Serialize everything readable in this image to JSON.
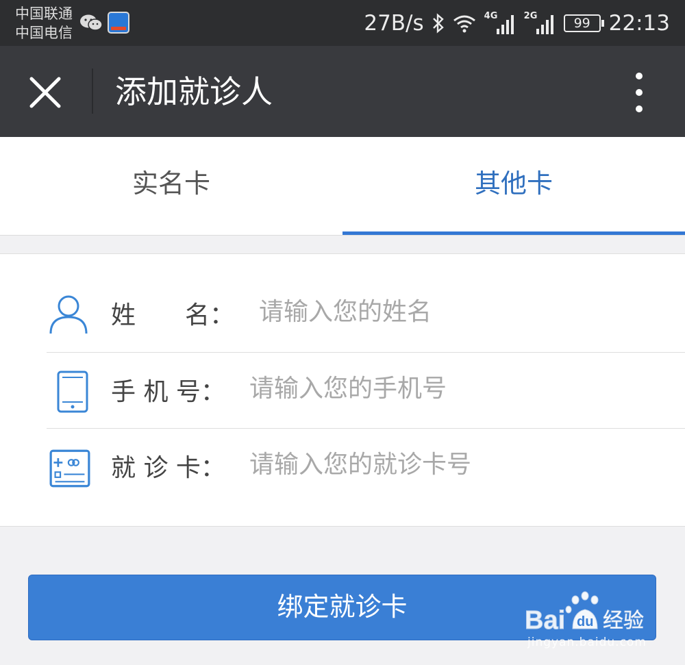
{
  "status_bar": {
    "carrier_1": "中国联通",
    "carrier_2": "中国电信",
    "net_speed": "27B/s",
    "sig_tag_1": "4G",
    "sig_tag_2": "2G",
    "battery": "99",
    "time": "22:13"
  },
  "title_bar": {
    "title": "添加就诊人"
  },
  "tabs": [
    {
      "label": "实名卡",
      "active": false
    },
    {
      "label": "其他卡",
      "active": true
    }
  ],
  "form": {
    "name_label": "姓　　名：",
    "name_placeholder": "请输入您的姓名",
    "phone_label": "手 机 号：",
    "phone_placeholder": "请输入您的手机号",
    "card_label": "就 诊 卡：",
    "card_placeholder": "请输入您的就诊卡号"
  },
  "submit_label": "绑定就诊卡",
  "watermark": {
    "site": "jingyan.baidu.com"
  },
  "colors": {
    "accent": "#3a7fd5",
    "active_tab": "#2f6fbe",
    "titlebar": "#393a3e",
    "statusbar": "#2d2e30"
  }
}
